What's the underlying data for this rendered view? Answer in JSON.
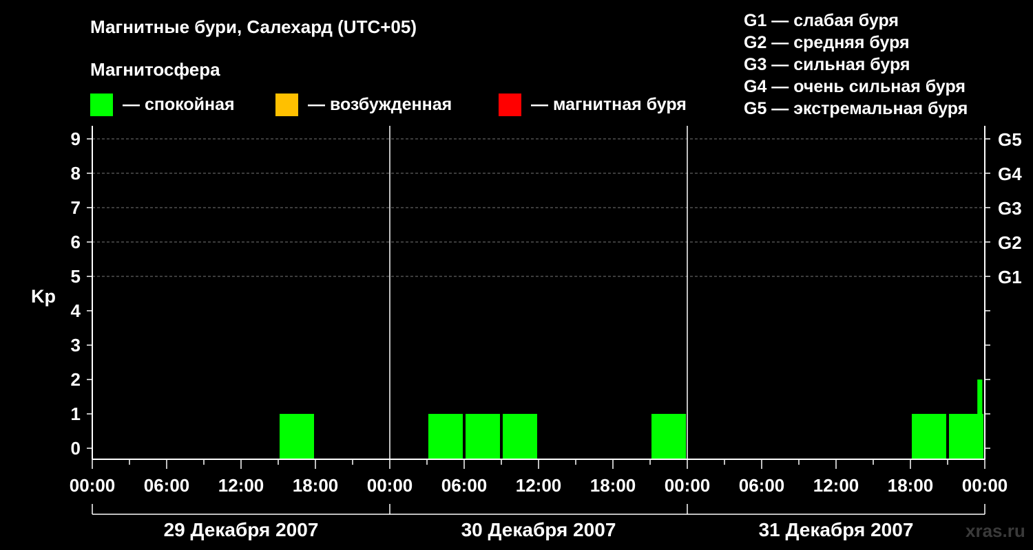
{
  "title": "Магнитные бури, Салехард (UTC+05)",
  "subtitle": "Магнитосфера",
  "legend": [
    {
      "label": "— спокойная",
      "color": "#00ff00"
    },
    {
      "label": "— возбужденная",
      "color": "#ffc000"
    },
    {
      "label": "— магнитная буря",
      "color": "#ff0000"
    }
  ],
  "g_scale": [
    "G1 — слабая буря",
    "G2 — средняя буря",
    "G3 — сильная буря",
    "G4 — очень сильная буря",
    "G5 — экстремальная буря"
  ],
  "watermark": "xras.ru",
  "chart_data": {
    "type": "bar",
    "ylabel": "Kp",
    "ylim": [
      0,
      9
    ],
    "yticks": [
      "0",
      "1",
      "2",
      "3",
      "4",
      "5",
      "6",
      "7",
      "8",
      "9"
    ],
    "g_levels": [
      {
        "label": "G1",
        "kp": 5
      },
      {
        "label": "G2",
        "kp": 6
      },
      {
        "label": "G3",
        "kp": 7
      },
      {
        "label": "G4",
        "kp": 8
      },
      {
        "label": "G5",
        "kp": 9
      }
    ],
    "x_tick_labels": [
      "00:00",
      "06:00",
      "12:00",
      "18:00",
      "00:00",
      "06:00",
      "12:00",
      "18:00",
      "00:00",
      "06:00",
      "12:00",
      "18:00",
      "00:00"
    ],
    "days": [
      "29 Декабря 2007",
      "30 Декабря 2007",
      "31 Декабря 2007"
    ],
    "interval_hours": 3,
    "kp_values": [
      [
        0,
        0,
        0,
        0,
        0,
        1,
        0,
        0
      ],
      [
        0,
        1,
        1,
        1,
        0,
        0,
        0,
        1
      ],
      [
        0,
        0,
        0,
        0,
        0,
        0,
        1,
        1
      ]
    ],
    "partial_bar": {
      "day_index": 2,
      "start_hour": 24,
      "kp": 2
    },
    "grid": true
  }
}
